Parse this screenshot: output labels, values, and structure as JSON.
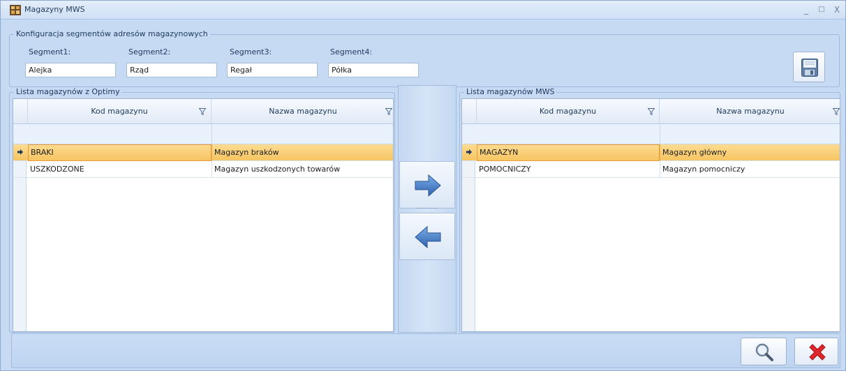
{
  "window": {
    "title": "Magazyny MWS",
    "controls": {
      "minimize": "_",
      "maximize": "□",
      "close": "X"
    }
  },
  "config": {
    "group_title": "Konfiguracja segmentów adresów magazynowych",
    "segments": [
      {
        "label": "Segment1:",
        "value": "Alejka"
      },
      {
        "label": "Segment2:",
        "value": "Rząd"
      },
      {
        "label": "Segment3:",
        "value": "Regał"
      },
      {
        "label": "Segment4:",
        "value": "Półka"
      }
    ],
    "save_icon": "floppy-disk-icon"
  },
  "optima_list": {
    "group_title": "Lista magazynów z Optimy",
    "columns": [
      "Kod magazynu",
      "Nazwa magazynu"
    ],
    "rows": [
      {
        "code": "BRAKI",
        "name": "Magazyn braków",
        "selected": true
      },
      {
        "code": "USZKODZONE",
        "name": "Magazyn uszkodzonych towarów",
        "selected": false
      }
    ]
  },
  "mws_list": {
    "group_title": "Lista magazynów MWS",
    "columns": [
      "Kod magazynu",
      "Nazwa magazynu"
    ],
    "rows": [
      {
        "code": "MAGAZYN",
        "name": "Magazyn główny",
        "selected": true
      },
      {
        "code": "POMOCNICZY",
        "name": "Magazyn pomocniczy",
        "selected": false
      }
    ]
  },
  "transfer": {
    "right_icon": "arrow-right-icon",
    "left_icon": "arrow-left-icon"
  },
  "footer": {
    "search_icon": "magnifier-icon",
    "close_icon": "red-x-icon"
  },
  "colors": {
    "selection": "#f9d27a",
    "selection_border": "#e89a3c",
    "arrow_blue": "#3e77c4",
    "close_red": "#e0272b",
    "window_bg": "#c6daf4"
  }
}
